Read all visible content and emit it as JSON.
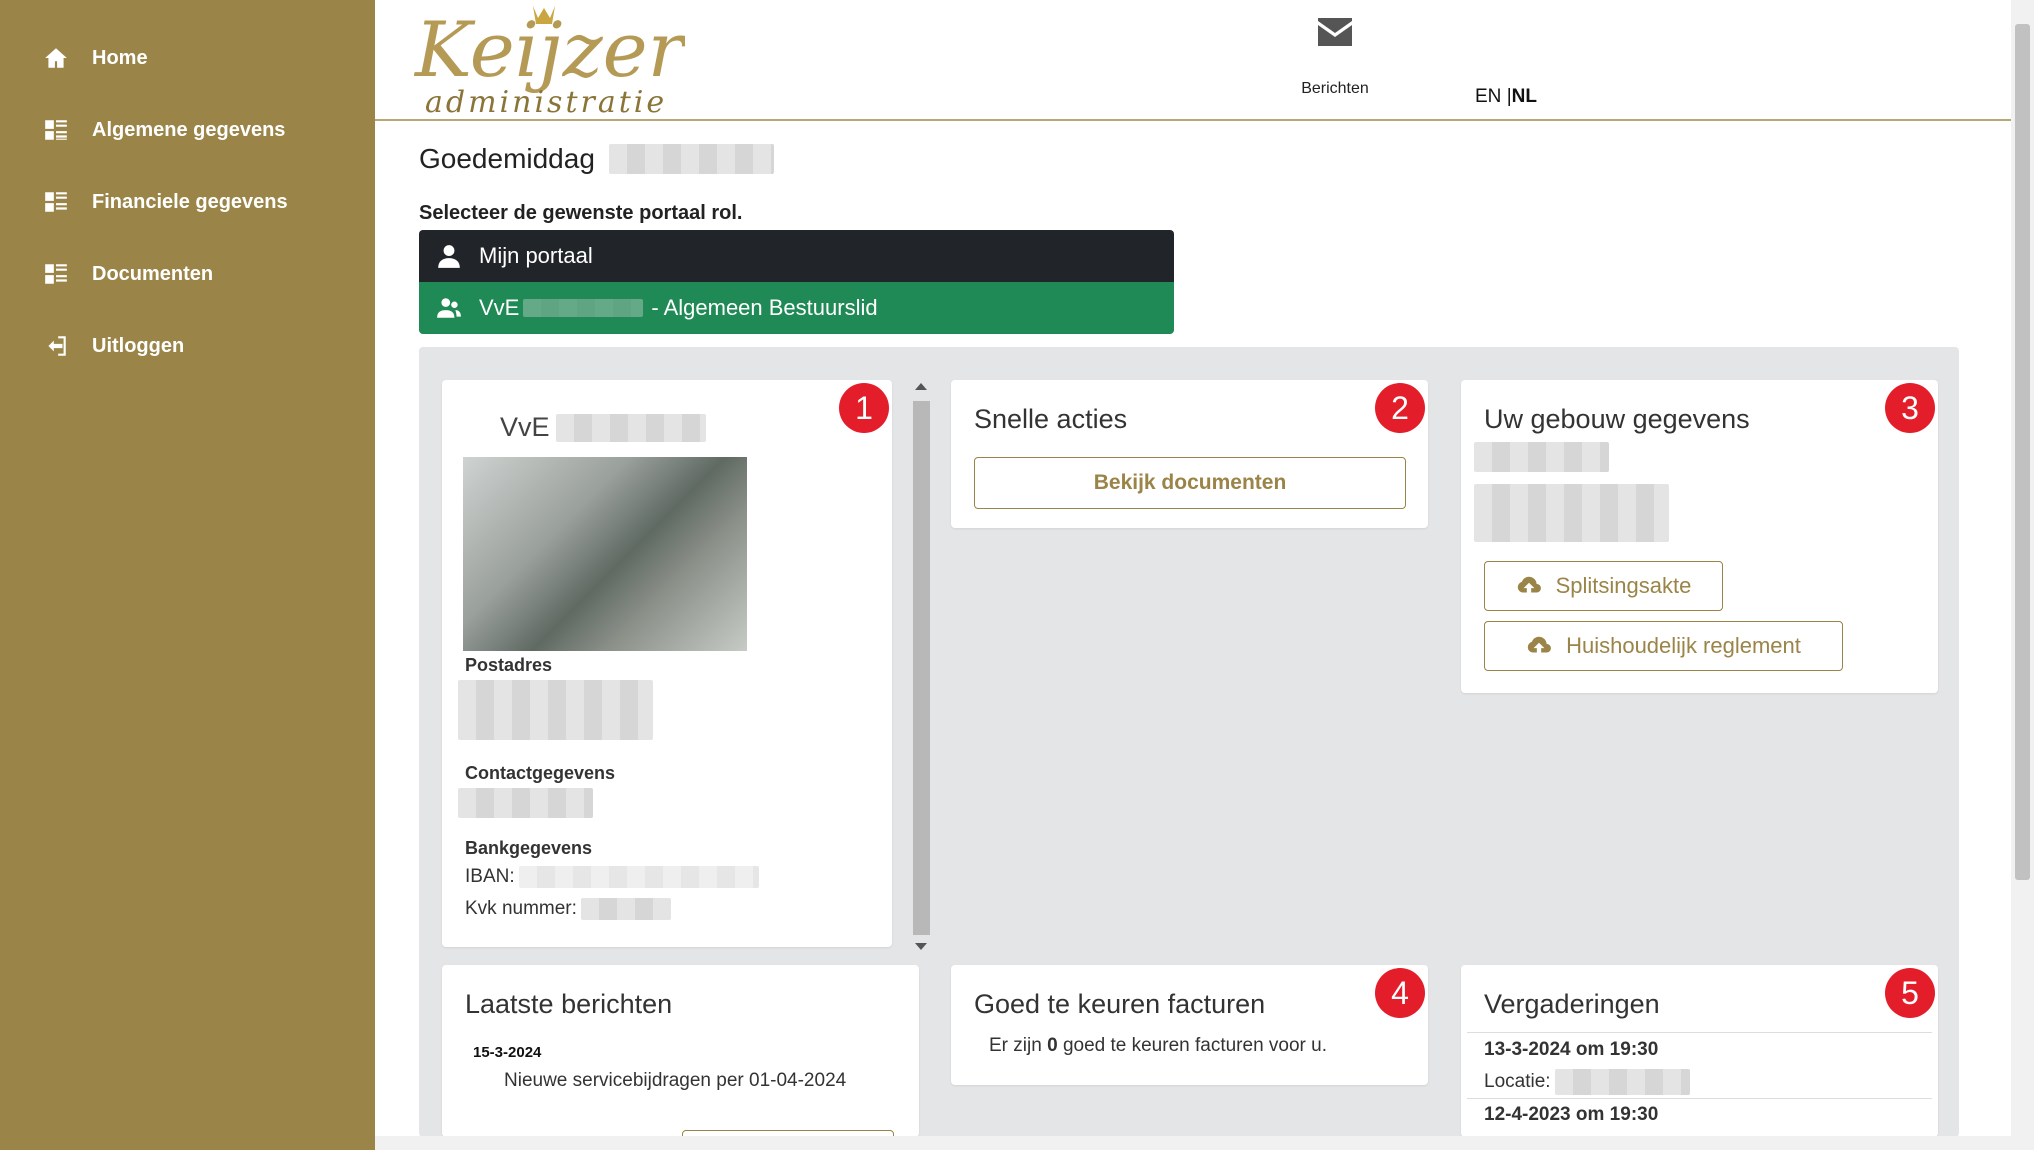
{
  "sidebar": {
    "items": [
      {
        "label": "Home",
        "icon": "home-icon"
      },
      {
        "label": "Algemene gegevens",
        "icon": "list-icon"
      },
      {
        "label": "Financiele gegevens",
        "icon": "list-icon"
      },
      {
        "label": "Documenten",
        "icon": "list-icon"
      },
      {
        "label": "Uitloggen",
        "icon": "logout-icon"
      }
    ],
    "color": "#9a8447"
  },
  "header": {
    "logo_top": "Keijzer",
    "logo_bottom": "administratie",
    "messages_label": "Berichten",
    "lang_en": "EN",
    "lang_sep": "|",
    "lang_nl": "NL"
  },
  "main": {
    "greeting": "Goedemiddag",
    "role_title": "Selecteer de gewenste portaal rol.",
    "roles": [
      {
        "label": "Mijn portaal",
        "color": "#212529"
      },
      {
        "prefix": "VvE",
        "suffix": "- Algemeen Bestuurslid",
        "color": "#1f8a56"
      }
    ]
  },
  "cards": {
    "vve": {
      "badge": "1",
      "title_prefix": "VvE",
      "postadres_label": "Postadres",
      "contact_label": "Contactgegevens",
      "bank_label": "Bankgegevens",
      "iban_label": "IBAN:",
      "kvk_label": "Kvk nummer:"
    },
    "snelle": {
      "badge": "2",
      "title": "Snelle acties",
      "button": "Bekijk documenten"
    },
    "gebouw": {
      "badge": "3",
      "title": "Uw gebouw gegevens",
      "btn1": "Splitsingsakte",
      "btn2": "Huishoudelijk reglement"
    },
    "berichten": {
      "title": "Laatste berichten",
      "date": "15-3-2024",
      "message": "Nieuwe servicebijdragen per 01-04-2024"
    },
    "facturen": {
      "badge": "4",
      "title": "Goed te keuren facturen",
      "text_before": "Er zijn",
      "count": "0",
      "text_after": "goed te keuren facturen voor u."
    },
    "vergaderingen": {
      "badge": "5",
      "title": "Vergaderingen",
      "items": [
        {
          "datetime": "13-3-2024 om 19:30",
          "locatie_label": "Locatie:"
        },
        {
          "datetime": "12-4-2023 om 19:30"
        }
      ]
    }
  },
  "colors": {
    "badge": "#e31e2a",
    "gold": "#9a8447",
    "dark": "#212529",
    "green": "#1f8a56"
  }
}
